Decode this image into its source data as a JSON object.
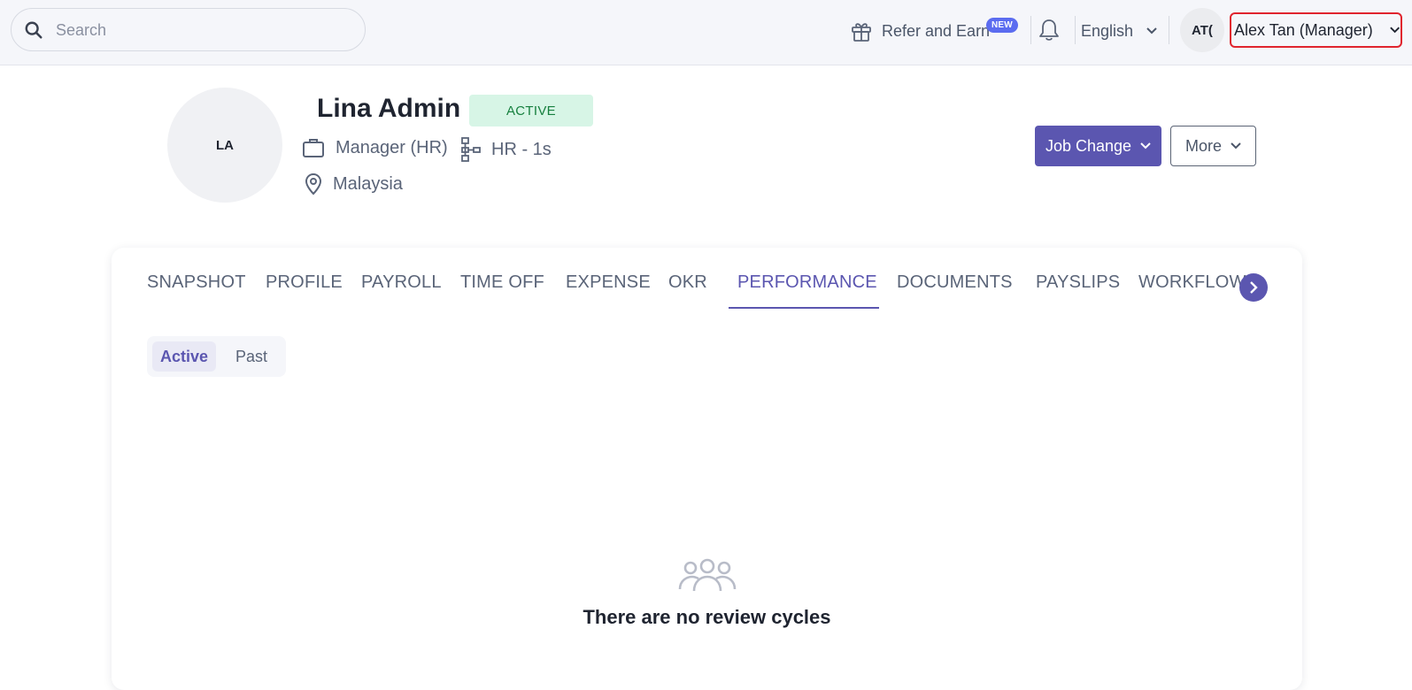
{
  "header": {
    "search": {
      "placeholder": "Search",
      "value": ""
    },
    "refer": {
      "label": "Refer and Earn",
      "badge": "NEW"
    },
    "language": {
      "selected": "English"
    },
    "user": {
      "initials": "AT(",
      "name": "Alex Tan (Manager)"
    }
  },
  "profile": {
    "initials": "LA",
    "name": "Lina Admin",
    "status": "ACTIVE",
    "job_title": "Manager (HR)",
    "org": "HR - 1s",
    "location": "Malaysia",
    "actions": {
      "job_change": "Job Change",
      "more": "More"
    }
  },
  "tabs": {
    "items": [
      "SNAPSHOT",
      "PROFILE",
      "PAYROLL",
      "TIME OFF",
      "EXPENSE",
      "OKR",
      "PERFORMANCE",
      "DOCUMENTS",
      "PAYSLIPS",
      "WORKFLOW"
    ],
    "active": "PERFORMANCE"
  },
  "performance": {
    "segments": {
      "active": "Active",
      "past": "Past"
    },
    "empty_message": "There are no review cycles"
  },
  "colors": {
    "accent": "#5b56b0",
    "status_bg": "#d7f5e6",
    "status_fg": "#17803f",
    "highlight": "#e0242e"
  }
}
